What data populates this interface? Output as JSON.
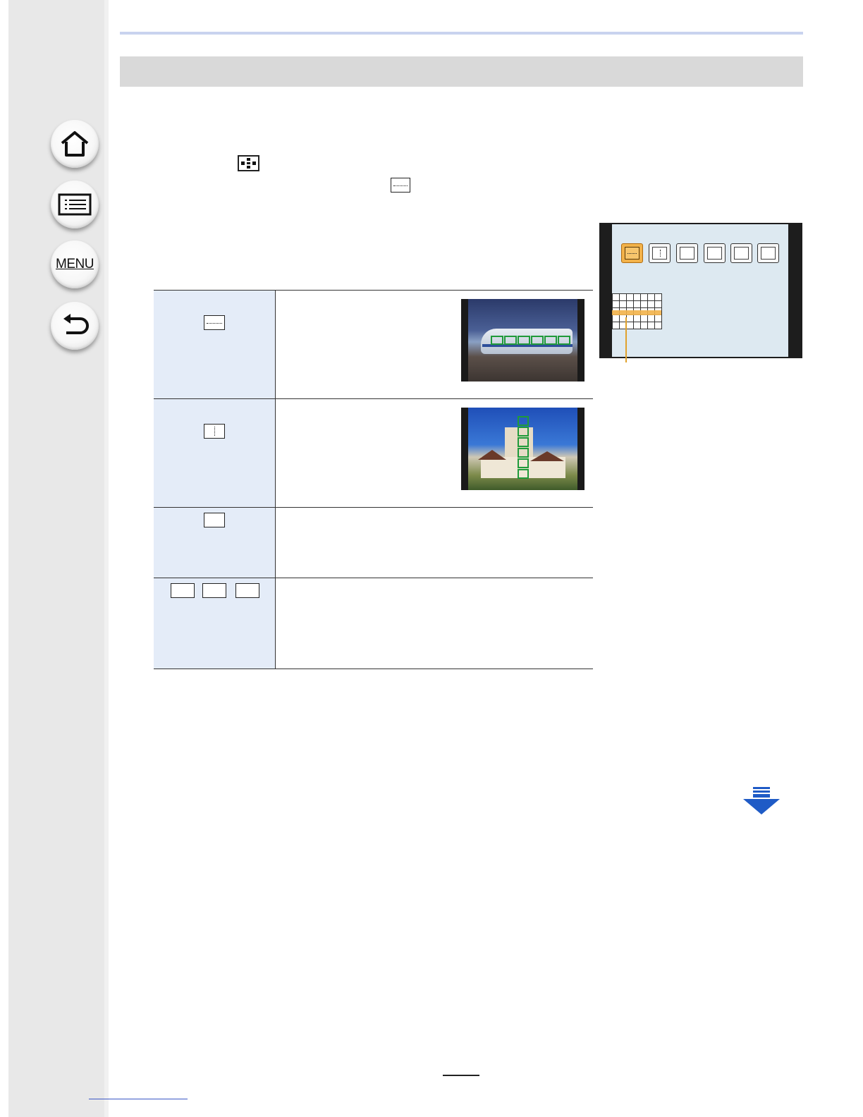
{
  "sidebar": {
    "items": [
      {
        "name": "home",
        "icon": "home-icon"
      },
      {
        "name": "contents",
        "icon": "contents-list-icon"
      },
      {
        "name": "menu",
        "label": "MENU"
      },
      {
        "name": "back",
        "icon": "back-arrow-icon"
      }
    ]
  },
  "colors": {
    "sidebar_bg": "#e8e8e8",
    "title_bar": "#d9d9d9",
    "accent_rule": "#c9d3ef",
    "table_left_bg": "#e4ecf8",
    "selected_orange": "#f2b24a",
    "next_arrow": "#1f5bc6"
  },
  "camera_screen": {
    "mode_icons": [
      "horizontal-pattern-icon",
      "vertical-pattern-icon",
      "custom-1-icon",
      "custom-2-icon",
      "custom-3-icon",
      "custom-4-icon"
    ],
    "selected_index": 0
  },
  "table": {
    "rows": [
      {
        "icon": "horizontal-pattern-icon",
        "has_photo": true,
        "photo": "train-photo"
      },
      {
        "icon": "vertical-pattern-icon",
        "has_photo": true,
        "photo": "building-photo"
      },
      {
        "icon": "custom-single-icon",
        "has_photo": false
      },
      {
        "icons": [
          "custom-1-icon",
          "custom-2-icon",
          "custom-3-icon"
        ],
        "has_photo": false
      }
    ]
  },
  "navigation": {
    "next_page_icon": "next-page-arrow-icon"
  }
}
